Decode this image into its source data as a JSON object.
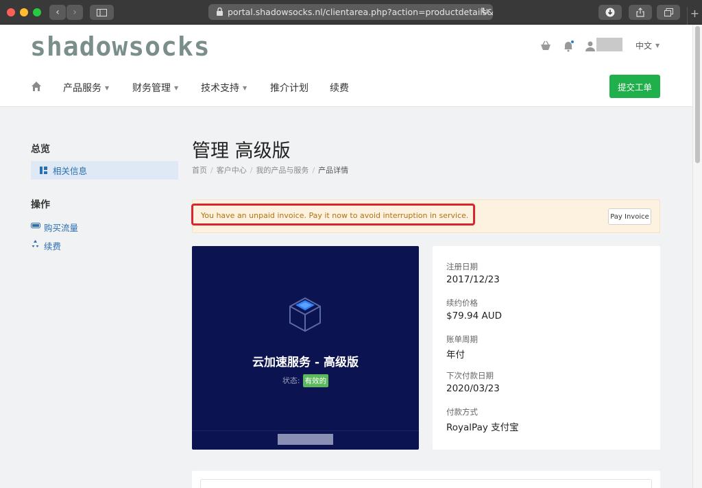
{
  "browser": {
    "url": "portal.shadowsocks.nl/clientarea.php?action=productdetails&i"
  },
  "header": {
    "logo": "shadowsocks",
    "lang": "中文",
    "nav": [
      "产品服务",
      "财务管理",
      "技术支持",
      "推介计划",
      "续费"
    ],
    "submit_ticket": "提交工单"
  },
  "sidebar": {
    "overview_heading": "总览",
    "overview_item": "相关信息",
    "actions_heading": "操作",
    "actions": [
      "购买流量",
      "续费"
    ]
  },
  "main": {
    "title": "管理 高级版",
    "breadcrumb": [
      "首页",
      "客户中心",
      "我的产品与服务",
      "产品详情"
    ],
    "alert_text": "You have an unpaid invoice. Pay it now to avoid interruption in service.",
    "pay_button": "Pay Invoice",
    "product": {
      "name": "云加速服务 - 高级版",
      "status_label": "状态:",
      "status_value": "有效的"
    },
    "details": [
      {
        "label": "注册日期",
        "value": "2017/12/23"
      },
      {
        "label": "续约价格",
        "value": "$79.94 AUD"
      },
      {
        "label": "账单周期",
        "value": "年付"
      },
      {
        "label": "下次付款日期",
        "value": "2020/03/23"
      },
      {
        "label": "付款方式",
        "value": "RoyalPay 支付宝"
      }
    ]
  },
  "colors": {
    "accent_green": "#1fb04c",
    "link_blue": "#2a6fb0",
    "product_bg": "#0b1350",
    "alert_bg": "#fdf1e0",
    "highlight_red": "#d8262e"
  }
}
